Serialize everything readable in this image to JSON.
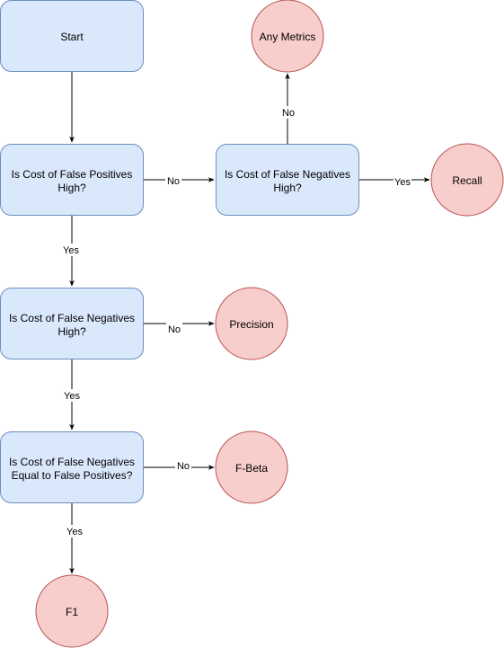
{
  "colors": {
    "decision_fill": "#dae8fc",
    "decision_stroke": "#6c8ebf",
    "terminal_fill": "#f8cecc",
    "terminal_stroke": "#b85450",
    "edge": "#000000"
  },
  "nodes": {
    "start": {
      "label": "Start"
    },
    "fp_high": {
      "label_lines": [
        "Is Cost of False Positives",
        "High?"
      ]
    },
    "fn_high_top": {
      "label_lines": [
        "Is Cost of False Negatives",
        "High?"
      ]
    },
    "fn_high": {
      "label_lines": [
        "Is Cost of False Negatives",
        "High?"
      ]
    },
    "fn_equal_fp": {
      "label_lines": [
        "Is Cost of False Negatives",
        "Equal to False Positives?"
      ]
    },
    "any_metrics": {
      "label": "Any Metrics"
    },
    "recall": {
      "label": "Recall"
    },
    "precision": {
      "label": "Precision"
    },
    "f_beta": {
      "label": "F-Beta"
    },
    "f1": {
      "label": "F1"
    }
  },
  "edges": {
    "start_to_fp": {
      "label": ""
    },
    "fp_to_fntop": {
      "label": "No"
    },
    "fntop_to_any": {
      "label": "No"
    },
    "fntop_to_recall": {
      "label": "Yes"
    },
    "fp_to_fn": {
      "label": "Yes"
    },
    "fn_to_precision": {
      "label": "No"
    },
    "fn_to_equal": {
      "label": "Yes"
    },
    "equal_to_fbeta": {
      "label": "No"
    },
    "equal_to_f1": {
      "label": "Yes"
    }
  }
}
